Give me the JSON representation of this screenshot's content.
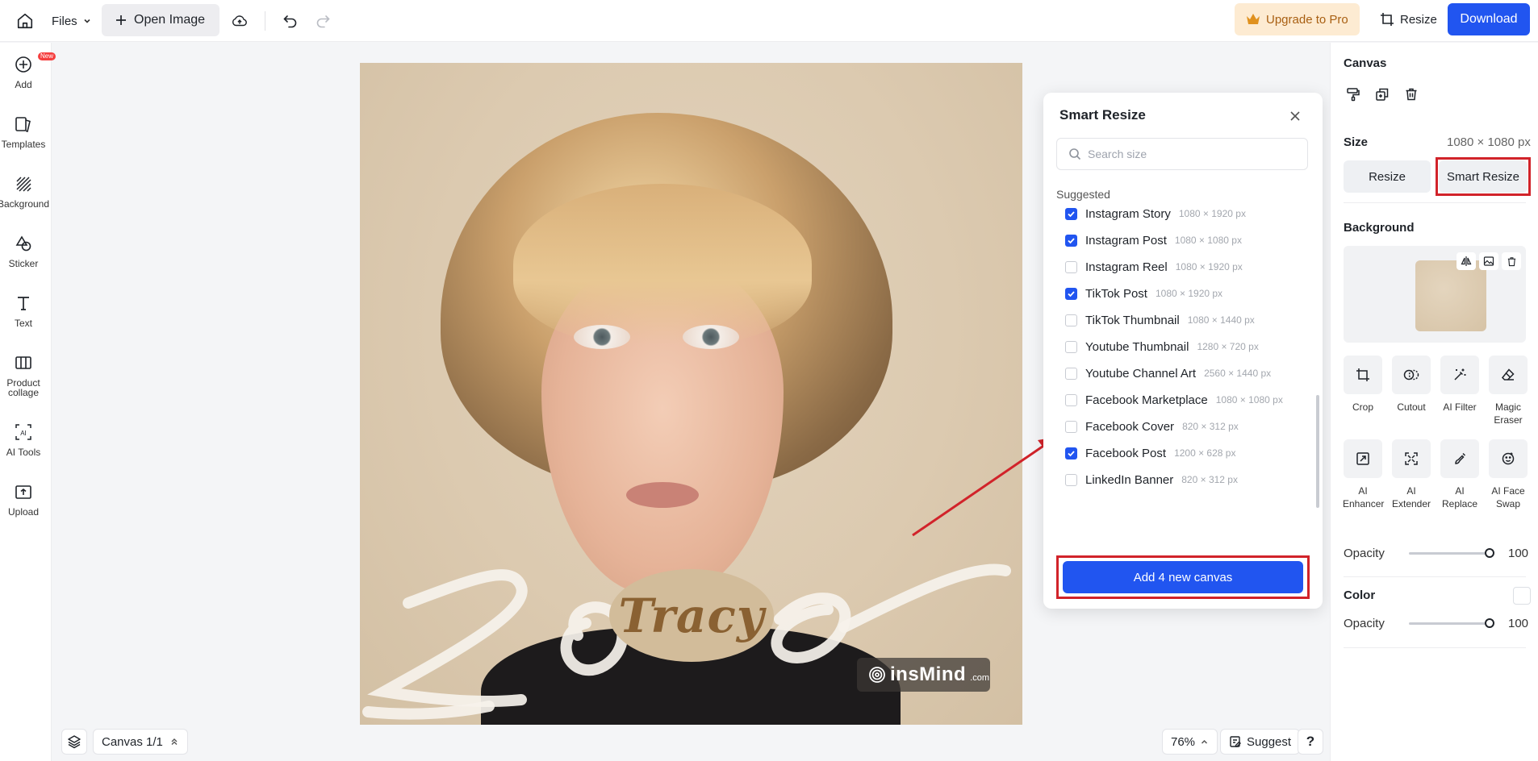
{
  "topbar": {
    "files_label": "Files",
    "open_image_label": "Open Image",
    "upgrade_label": "Upgrade to Pro",
    "resize_label": "Resize",
    "download_label": "Download"
  },
  "sidebar": {
    "new_badge": "New",
    "items": [
      {
        "label": "Add",
        "icon": "add-circle-icon"
      },
      {
        "label": "Templates",
        "icon": "templates-icon"
      },
      {
        "label": "Background",
        "icon": "background-icon"
      },
      {
        "label": "Sticker",
        "icon": "sticker-icon"
      },
      {
        "label": "Text",
        "icon": "text-icon"
      },
      {
        "label": "Product collage",
        "icon": "collage-icon"
      },
      {
        "label": "AI Tools",
        "icon": "ai-tools-icon"
      },
      {
        "label": "Upload",
        "icon": "upload-icon"
      }
    ]
  },
  "canvas": {
    "overlay_word": "Tracy",
    "watermark_name": "insMind",
    "watermark_domain": ".com"
  },
  "smart_resize": {
    "title": "Smart Resize",
    "search_placeholder": "Search size",
    "suggested_label": "Suggested",
    "items": [
      {
        "name": "Instagram Story",
        "size": "1080 × 1920 px",
        "checked": true
      },
      {
        "name": "Instagram Post",
        "size": "1080 × 1080 px",
        "checked": true
      },
      {
        "name": "Instagram Reel",
        "size": "1080 × 1920 px",
        "checked": false
      },
      {
        "name": "TikTok Post",
        "size": "1080 × 1920 px",
        "checked": true
      },
      {
        "name": "TikTok Thumbnail",
        "size": "1080 × 1440 px",
        "checked": false
      },
      {
        "name": "Youtube Thumbnail",
        "size": "1280 × 720 px",
        "checked": false
      },
      {
        "name": "Youtube Channel Art",
        "size": "2560 × 1440 px",
        "checked": false
      },
      {
        "name": "Facebook Marketplace",
        "size": "1080 × 1080 px",
        "checked": false
      },
      {
        "name": "Facebook Cover",
        "size": "820 × 312 px",
        "checked": false
      },
      {
        "name": "Facebook Post",
        "size": "1200 × 628 px",
        "checked": true
      },
      {
        "name": "LinkedIn Banner",
        "size": "820 × 312 px",
        "checked": false
      }
    ],
    "add_button_label": "Add 4 new canvas"
  },
  "bottom": {
    "canvas_count": "Canvas 1/1",
    "zoom": "76%",
    "suggest_label": "Suggest",
    "help_label": "?"
  },
  "right_panel": {
    "canvas_title": "Canvas",
    "size_label": "Size",
    "size_value": "1080 × 1080 px",
    "resize_label": "Resize",
    "smart_resize_label": "Smart Resize",
    "background_title": "Background",
    "tools": [
      {
        "label": "Crop",
        "icon": "crop-icon"
      },
      {
        "label": "Cutout",
        "icon": "cutout-icon"
      },
      {
        "label": "AI Filter",
        "icon": "ai-filter-icon"
      },
      {
        "label": "Magic Eraser",
        "icon": "magic-eraser-icon"
      },
      {
        "label": "AI Enhancer",
        "icon": "ai-enhancer-icon"
      },
      {
        "label": "AI Extender",
        "icon": "ai-extender-icon"
      },
      {
        "label": "AI Replace",
        "icon": "ai-replace-icon"
      },
      {
        "label": "AI Face Swap",
        "icon": "ai-face-swap-icon"
      }
    ],
    "opacity_label": "Opacity",
    "opacity_value": "100",
    "opacity_fraction": 1.0,
    "color_title": "Color",
    "color_opacity_label": "Opacity",
    "color_opacity_value": "100",
    "color_opacity_fraction": 1.0
  },
  "colors": {
    "accent": "#2155f0",
    "highlight_frame": "#d1232a",
    "upgrade_bg": "#fdebd2",
    "upgrade_text": "#a85f12"
  }
}
